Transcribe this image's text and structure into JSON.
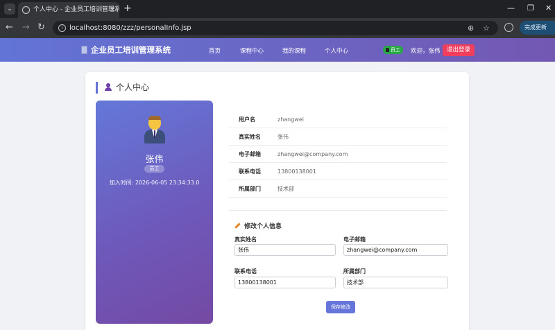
{
  "browser": {
    "tab_title": "个人中心 - 企业员工培训管理系统",
    "url": "localhost:8080/zzz/personalInfo.jsp",
    "update_label": "完成更新"
  },
  "header": {
    "brand": "企业员工培训管理系统",
    "nav": [
      "首页",
      "课程中心",
      "我的课程",
      "个人中心"
    ],
    "role_badge": "员工",
    "welcome": "欢迎，张伟",
    "logout": "退出登录"
  },
  "page": {
    "title": "个人中心"
  },
  "profile": {
    "name": "张伟",
    "role": "员工",
    "joined": "加入时间: 2026-06-05 23:34:33.0"
  },
  "info": [
    {
      "label": "用户名",
      "value": "zhangwei"
    },
    {
      "label": "真实姓名",
      "value": "张伟"
    },
    {
      "label": "电子邮箱",
      "value": "zhangwei@company.com"
    },
    {
      "label": "联系电话",
      "value": "13800138001"
    },
    {
      "label": "所属部门",
      "value": "技术部"
    }
  ],
  "edit": {
    "title": "修改个人信息",
    "fields": [
      {
        "label": "真实姓名",
        "value": "张伟"
      },
      {
        "label": "电子邮箱",
        "value": "zhangwei@company.com"
      },
      {
        "label": "联系电话",
        "value": "13800138001"
      },
      {
        "label": "所属部门",
        "value": "技术部"
      }
    ],
    "save": "保存修改"
  }
}
